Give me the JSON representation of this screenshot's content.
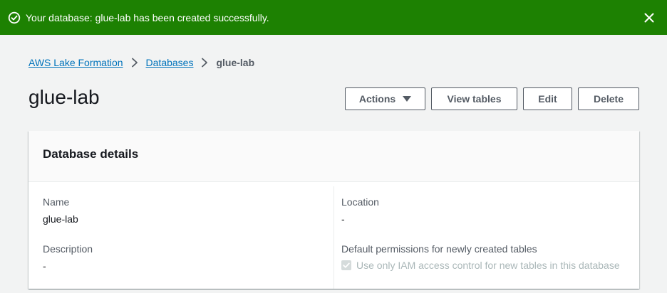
{
  "flash": {
    "message": "Your database: glue-lab has been created successfully."
  },
  "breadcrumb": {
    "items": [
      "AWS Lake Formation",
      "Databases"
    ],
    "current": "glue-lab"
  },
  "header": {
    "title": "glue-lab",
    "actions_label": "Actions",
    "view_tables_label": "View tables",
    "edit_label": "Edit",
    "delete_label": "Delete"
  },
  "details": {
    "title": "Database details",
    "name_label": "Name",
    "name_value": "glue-lab",
    "location_label": "Location",
    "location_value": "-",
    "description_label": "Description",
    "description_value": "-",
    "permissions_label": "Default permissions for newly created tables",
    "iam_checkbox_label": "Use only IAM access control for new tables in this database",
    "iam_checkbox_checked": true,
    "iam_checkbox_disabled": true
  },
  "colors": {
    "success_banner": "#1d8102",
    "link": "#0073bb",
    "button_border": "#545b64"
  }
}
